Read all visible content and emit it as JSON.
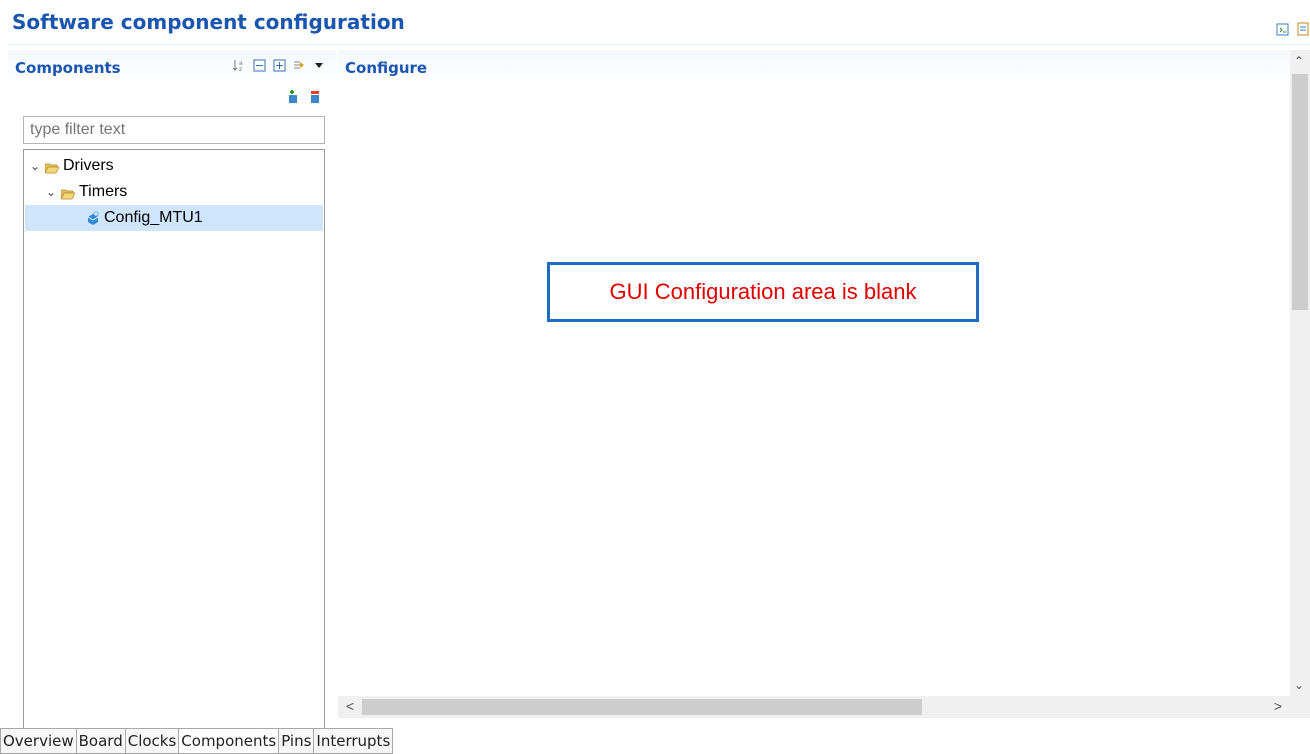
{
  "page": {
    "title": "Software component configuration"
  },
  "top_right_icons": [
    "generate-code-icon",
    "generate-report-icon"
  ],
  "components_panel": {
    "title": "Components",
    "toolbar_icons": [
      "sort-icon",
      "collapse-all-icon",
      "expand-all-icon",
      "link-icon",
      "view-menu-icon"
    ],
    "actions": [
      "add-component-icon",
      "remove-component-icon"
    ],
    "filter": {
      "placeholder": "type filter text",
      "value": ""
    },
    "tree": [
      {
        "label": "Drivers",
        "level": 0,
        "expanded": true,
        "type": "folder"
      },
      {
        "label": "Timers",
        "level": 1,
        "expanded": true,
        "type": "folder"
      },
      {
        "label": "Config_MTU1",
        "level": 2,
        "selected": true,
        "type": "component"
      }
    ]
  },
  "configure_panel": {
    "title": "Configure"
  },
  "annotation": {
    "text": "GUI Configuration area is blank",
    "text_color": "#e00000",
    "border_color": "#1f6dc0"
  },
  "tabs": [
    {
      "label": "Overview",
      "active": false
    },
    {
      "label": "Board",
      "active": false
    },
    {
      "label": "Clocks",
      "active": false
    },
    {
      "label": "Components",
      "active": true
    },
    {
      "label": "Pins",
      "active": false
    },
    {
      "label": "Interrupts",
      "active": false
    }
  ],
  "colors": {
    "title": "#1a56b0",
    "selection": "#cfe5fb"
  }
}
